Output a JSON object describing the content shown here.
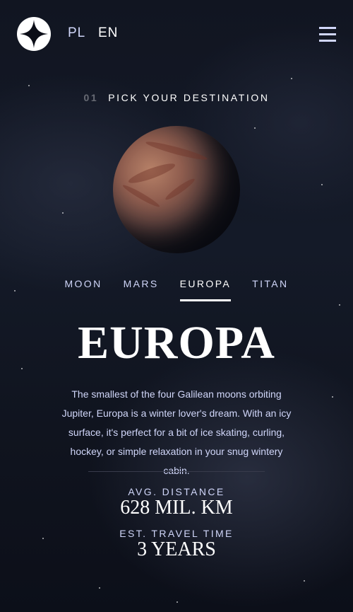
{
  "header": {
    "languages": [
      "PL",
      "EN"
    ],
    "menu_icon": "hamburger-icon",
    "logo_icon": "star-logo-icon"
  },
  "step": {
    "number": "01",
    "title": "PICK YOUR DESTINATION"
  },
  "tabs": [
    {
      "label": "MOON",
      "active": false
    },
    {
      "label": "MARS",
      "active": false
    },
    {
      "label": "EUROPA",
      "active": true
    },
    {
      "label": "TITAN",
      "active": false
    }
  ],
  "destination": {
    "name": "EUROPA",
    "description": "The smallest of the four Galilean moons orbiting Jupiter, Europa is a winter lover's dream. With an icy surface, it's perfect for a bit of ice skating, curling, hockey, or simple relaxation in your snug wintery cabin.",
    "distance_label": "AVG. DISTANCE",
    "distance_value": "628 MIL. KM",
    "travel_label": "EST. TRAVEL TIME",
    "travel_value": "3 YEARS"
  },
  "colors": {
    "background": "#0b0d17",
    "accent_text": "#d0d6f9",
    "white": "#ffffff"
  }
}
